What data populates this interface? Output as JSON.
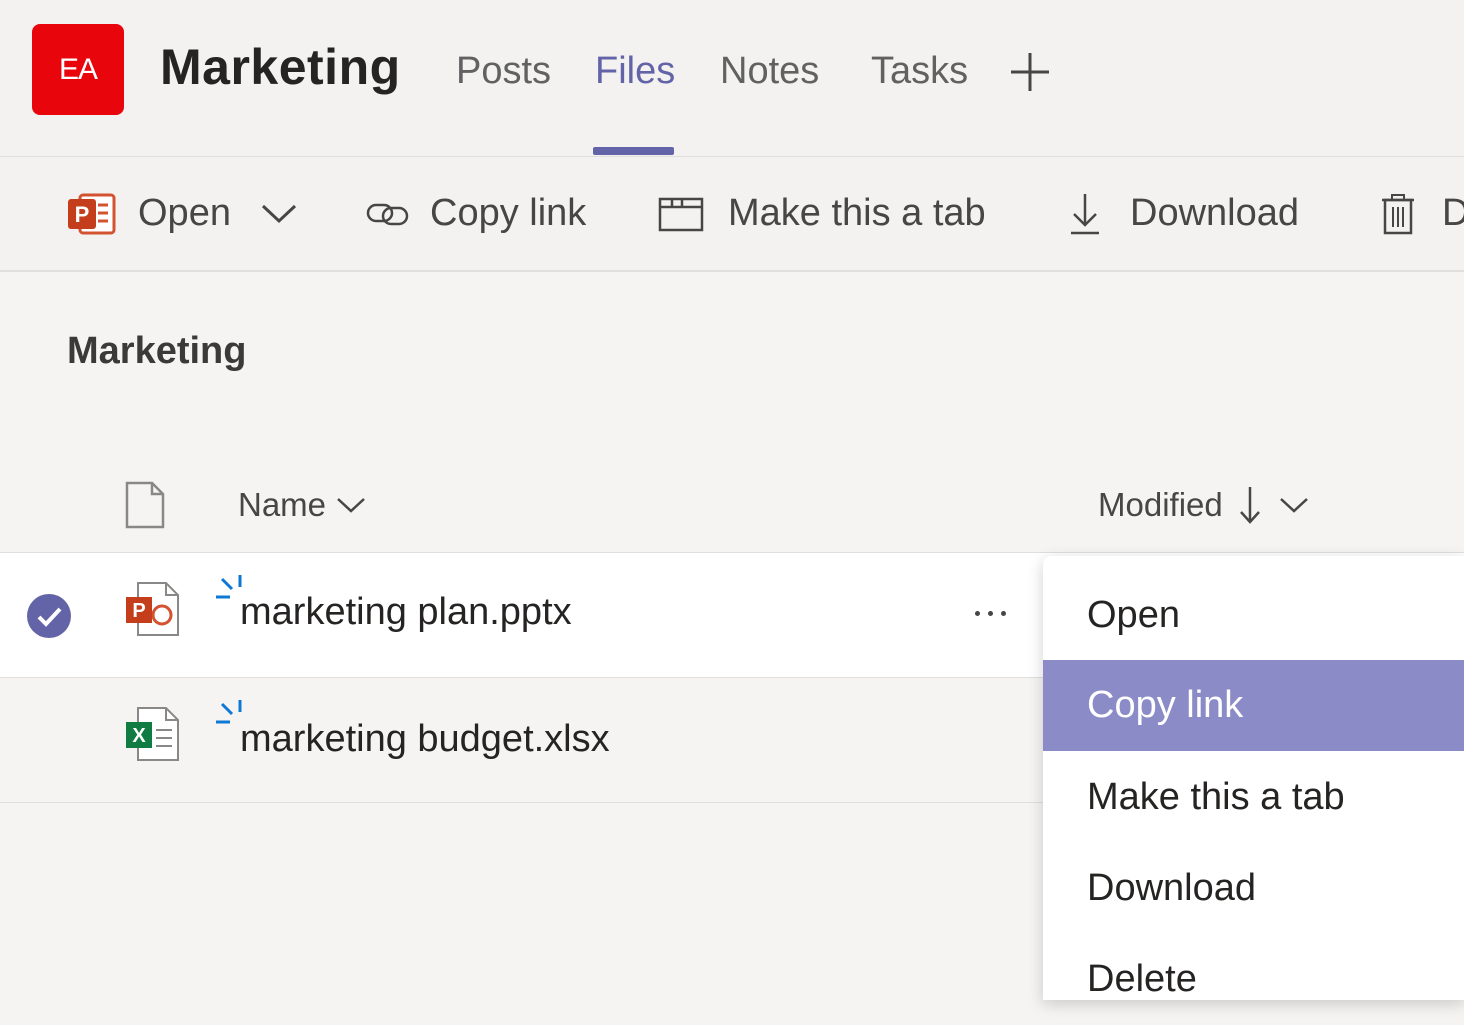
{
  "header": {
    "avatar_initials": "EA",
    "avatar_color": "#e8060c",
    "team_name": "Marketing",
    "tabs": [
      {
        "label": "Posts"
      },
      {
        "label": "Files",
        "active": true
      },
      {
        "label": "Notes"
      },
      {
        "label": "Tasks"
      }
    ],
    "add_tab_icon": "plus-icon",
    "accent_color": "#6264a7"
  },
  "toolbar": {
    "open_label": "Open",
    "copy_link_label": "Copy link",
    "make_tab_label": "Make this a tab",
    "download_label": "Download",
    "delete_label": "D"
  },
  "folder": {
    "title": "Marketing"
  },
  "list": {
    "columns": {
      "name": "Name",
      "modified": "Modified"
    },
    "rows": [
      {
        "name": "marketing plan.pptx",
        "type": "pptx",
        "selected": true
      },
      {
        "name": "marketing budget.xlsx",
        "type": "xlsx",
        "selected": false
      }
    ]
  },
  "context_menu": {
    "items": [
      {
        "label": "Open"
      },
      {
        "label": "Copy link",
        "highlighted": true
      },
      {
        "label": "Make this a tab"
      },
      {
        "label": "Download"
      },
      {
        "label": "Delete"
      }
    ],
    "highlight_color": "#8b8cc7"
  }
}
